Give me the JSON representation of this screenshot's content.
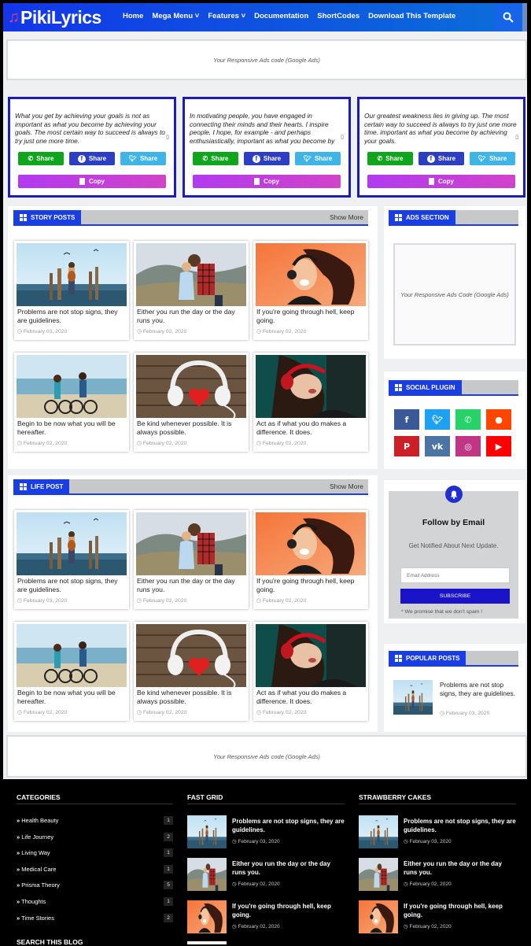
{
  "header": {
    "logo_text": "PikiLyrics",
    "nav": [
      "Home",
      "Mega Menu ˅",
      "Features ˅",
      "Documentation",
      "ShortCodes",
      "Download This Template"
    ]
  },
  "ads": {
    "top": "Your Responsive Ads code (Google Ads)",
    "bottom": "Your Responsive Ads code (Google Ads)",
    "sidebar": "Your Responsive Ads Code (Google Ads)"
  },
  "quotes": [
    {
      "text": "What you get by achieving your goals is not as important as what you become by achieving your goals. The most certain way to succeed is always to try just one more time."
    },
    {
      "text": "In motivating people, you have engaged in connecting their minds and their hearts. I inspire people, I hope, for example - and perhaps enthusiastically, important as what you become by"
    },
    {
      "text": "Our greatest weakness lies in giving up. The most certain way to succeed is always to try just one more time. important as what you become by achieving your goals."
    }
  ],
  "share": {
    "whatsapp": "Share",
    "facebook": "Share",
    "twitter": "Share",
    "copy": "Copy"
  },
  "story_section": {
    "title": "STORY POSTS",
    "more": "Show More"
  },
  "life_section": {
    "title": "LIFE POST",
    "more": "Show More"
  },
  "posts": [
    {
      "title": "Problems are not stop signs, they are guidelines.",
      "date": "February 03, 2020",
      "img": "beach"
    },
    {
      "title": "Either you run the day or the day runs you.",
      "date": "February 02, 2020",
      "img": "couple"
    },
    {
      "title": "If you're going through hell, keep going.",
      "date": "February 02, 2020",
      "img": "music"
    },
    {
      "title": "Begin to be now what you will be hereafter.",
      "date": "February 02, 2020",
      "img": "bikes"
    },
    {
      "title": "Be kind whenever possible. It is always possible.",
      "date": "February 02, 2020",
      "img": "headphones"
    },
    {
      "title": "Act as if what you do makes a difference. It does.",
      "date": "February 02, 2020",
      "img": "girl"
    }
  ],
  "sidebar": {
    "ads_title": "ADS SECTION",
    "social_title": "SOCIAL PLUGIN",
    "social": [
      {
        "icon": "facebook-icon",
        "color": "#3b5998"
      },
      {
        "icon": "twitter-icon",
        "color": "#1da1f2"
      },
      {
        "icon": "whatsapp-icon",
        "color": "#25d366"
      },
      {
        "icon": "reddit-icon",
        "color": "#ff4500"
      },
      {
        "icon": "pinterest-icon",
        "color": "#cb2027"
      },
      {
        "icon": "vk-icon",
        "color": "#4c75a3"
      },
      {
        "icon": "instagram-icon",
        "color": "#c13584"
      },
      {
        "icon": "youtube-icon",
        "color": "#ff0000"
      }
    ],
    "follow": {
      "title": "Follow by Email",
      "desc": "Get Notified About Next Update.",
      "placeholder": "Email Address",
      "button": "SUBSCRIBE",
      "note": "* We promise that we don't spam !"
    },
    "popular_title": "POPULAR POSTS",
    "popular": {
      "title": "Problems are not stop signs, they are guidelines.",
      "date": "February 03, 2020"
    }
  },
  "footer": {
    "categories_title": "CATEGORIES",
    "categories": [
      {
        "name": "Health Beauty",
        "count": "1"
      },
      {
        "name": "Life Journey",
        "count": "2"
      },
      {
        "name": "Living Way",
        "count": "1"
      },
      {
        "name": "Medical Care",
        "count": "1"
      },
      {
        "name": "Prisma Theory",
        "count": "5"
      },
      {
        "name": "Thoughts",
        "count": "1"
      },
      {
        "name": "Time Stories",
        "count": "2"
      }
    ],
    "search_title": "SEARCH THIS BLOG",
    "fast_grid_title": "FAST GRID",
    "strawberry_title": "STRAWBERRY CAKES",
    "items": [
      {
        "title": "Problems are not stop signs, they are guidelines.",
        "date": "February 03, 2020",
        "img": "beach"
      },
      {
        "title": "Either you run the day or the day runs you.",
        "date": "February 02, 2020",
        "img": "couple"
      },
      {
        "title": "If you're going through hell, keep going.",
        "date": "February 02, 2020",
        "img": "music"
      }
    ]
  },
  "colors": {
    "brand": "#1a3ee6",
    "quote_border": "#1d1cb5",
    "copy_gradient": "#b13af0"
  }
}
